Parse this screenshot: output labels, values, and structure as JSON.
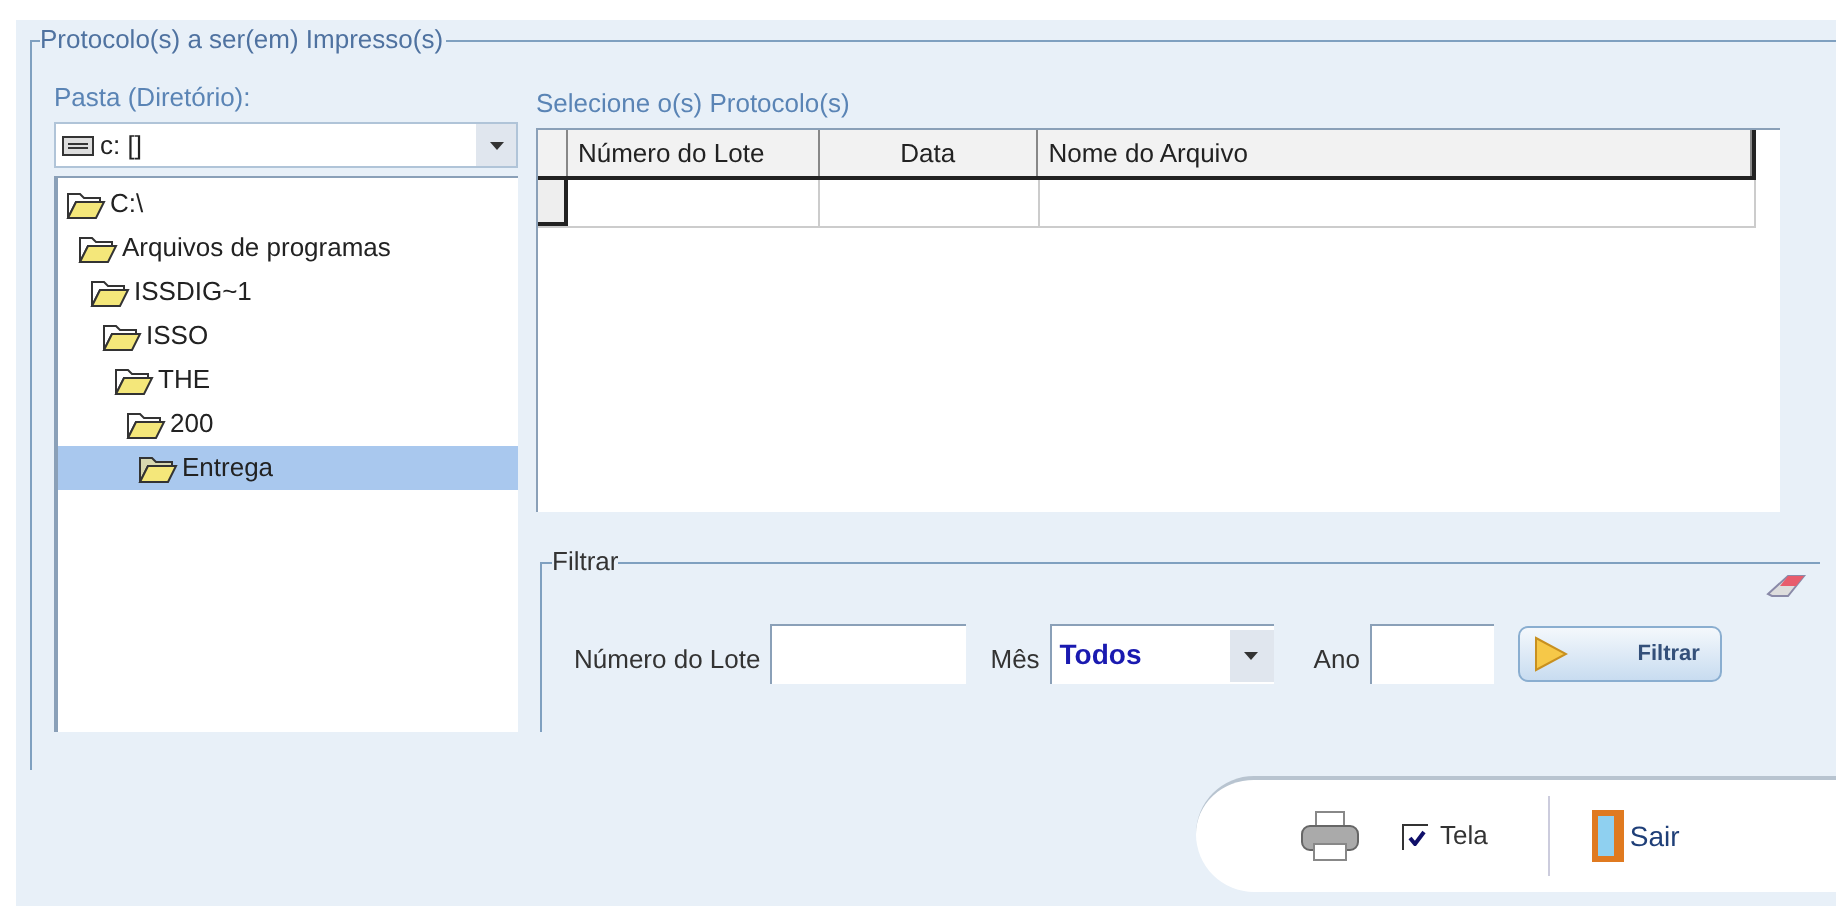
{
  "group_title": "Protocolo(s) a ser(em) Impresso(s)",
  "folder_panel": {
    "label": "Pasta (Diretório):",
    "drive_select": {
      "value": "c: []"
    },
    "tree": [
      {
        "label": "C:\\",
        "selected": false,
        "children": [
          {
            "label": "Arquivos de programas",
            "selected": false,
            "children": [
              {
                "label": "ISSDIG~1",
                "selected": false,
                "children": [
                  {
                    "label": "ISSO",
                    "selected": false,
                    "children": [
                      {
                        "label": "THE",
                        "selected": false,
                        "children": [
                          {
                            "label": "200",
                            "selected": false,
                            "children": [
                              {
                                "label": "Entrega",
                                "selected": true
                              }
                            ]
                          }
                        ]
                      }
                    ]
                  }
                ]
              }
            ]
          }
        ]
      }
    ]
  },
  "protocols": {
    "label": "Selecione o(s) Protocolo(s)",
    "table": {
      "columns": [
        "Número do Lote",
        "Data",
        "Nome do Arquivo"
      ]
    }
  },
  "filter": {
    "title": "Filtrar",
    "fields": [
      {
        "kind": "text",
        "label": "Número do Lote"
      },
      {
        "kind": "select",
        "label": "Mês",
        "value": "Todos"
      },
      {
        "kind": "text",
        "label": "Ano"
      }
    ],
    "button": "Filtrar"
  },
  "footer": {
    "screen_checkbox": {
      "label": "Tela",
      "checked": true
    },
    "exit_button": "Sair"
  }
}
